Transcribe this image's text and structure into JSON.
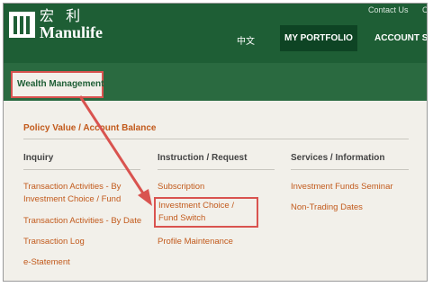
{
  "brand": {
    "cn": "宏 利",
    "en": "Manulife"
  },
  "top_links": [
    "Contact Us",
    "Co"
  ],
  "nav": {
    "lang": "中文",
    "portfolio": "MY PORTFOLIO",
    "account": "ACCOUNT SI"
  },
  "tab": {
    "label": "Wealth Management"
  },
  "policy_link": "Policy Value / Account Balance",
  "columns": [
    {
      "heading": "Inquiry",
      "links": [
        "Transaction Activities - By Investment Choice / Fund",
        "Transaction Activities - By Date",
        "Transaction Log",
        "e-Statement"
      ]
    },
    {
      "heading": "Instruction / Request",
      "links": [
        "Subscription",
        "Investment Choice / Fund Switch",
        "Profile Maintenance"
      ]
    },
    {
      "heading": "Services / Information",
      "links": [
        "Investment Funds Seminar",
        "Non-Trading Dates"
      ]
    }
  ],
  "colors": {
    "brand_green": "#1e5e35",
    "link_orange": "#c25a1c",
    "highlight_red": "#d9534f"
  }
}
